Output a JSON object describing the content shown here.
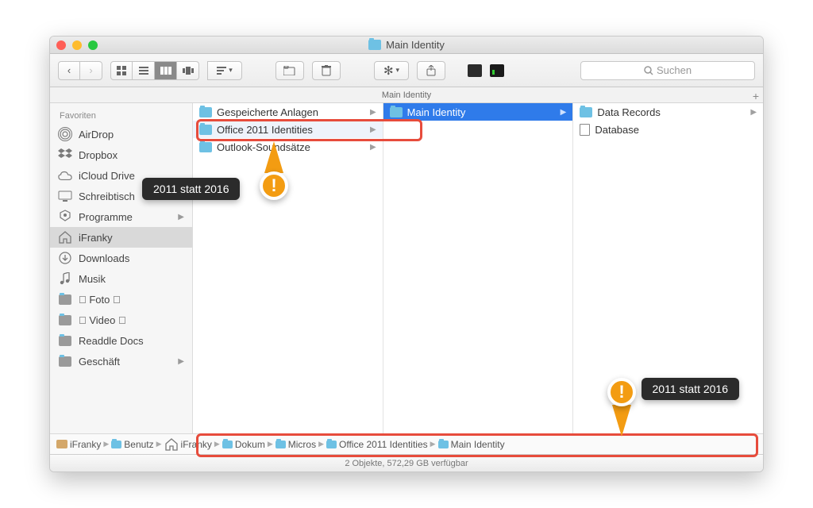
{
  "window": {
    "title": "Main Identity"
  },
  "pathbar": {
    "label": "Main Identity"
  },
  "search": {
    "placeholder": "Suchen"
  },
  "sidebar": {
    "header": "Favoriten",
    "items": [
      {
        "label": "AirDrop",
        "icon": "airdrop"
      },
      {
        "label": "Dropbox",
        "icon": "dropbox"
      },
      {
        "label": "iCloud Drive",
        "icon": "icloud"
      },
      {
        "label": "Schreibtisch",
        "icon": "desktop",
        "chevron": true
      },
      {
        "label": "Programme",
        "icon": "apps",
        "chevron": true
      },
      {
        "label": "iFranky",
        "icon": "home",
        "selected": true
      },
      {
        "label": "Downloads",
        "icon": "downloads"
      },
      {
        "label": "Musik",
        "icon": "music"
      },
      {
        "label": " Foto ",
        "icon": "folder"
      },
      {
        "label": " Video ",
        "icon": "folder"
      },
      {
        "label": "Readdle Docs",
        "icon": "folder"
      },
      {
        "label": "Geschäft",
        "icon": "folder",
        "chevron": true
      }
    ]
  },
  "columns": {
    "col1": [
      {
        "label": "Gespeicherte Anlagen",
        "chevron": true
      },
      {
        "label": "Office 2011 Identities",
        "chevron": true,
        "selected_soft": true
      },
      {
        "label": "Outlook-Soundsätze",
        "chevron": true
      }
    ],
    "col2": [
      {
        "label": "Main Identity",
        "chevron": true,
        "selected": true
      }
    ],
    "col3": [
      {
        "label": "Data Records",
        "type": "folder",
        "chevron": true
      },
      {
        "label": "Database",
        "type": "doc"
      }
    ]
  },
  "breadcrumb": {
    "segs": [
      {
        "label": "iFranky",
        "icon": "hd"
      },
      {
        "label": "Benutzer",
        "icon": "folder",
        "trunc": "Benutz"
      },
      {
        "label": "iFranky",
        "icon": "home"
      },
      {
        "label": "Dokumente",
        "icon": "folder",
        "trunc": "Dokum"
      },
      {
        "label": "Microsoft",
        "icon": "folder",
        "trunc": "Micros"
      },
      {
        "label": "Office 2011 Identities",
        "icon": "folder"
      },
      {
        "label": "Main Identity",
        "icon": "folder"
      }
    ]
  },
  "status": {
    "text": "2 Objekte, 572,29 GB verfügbar"
  },
  "callouts": {
    "a": "2011 statt 2016",
    "b": "2011 statt 2016"
  }
}
